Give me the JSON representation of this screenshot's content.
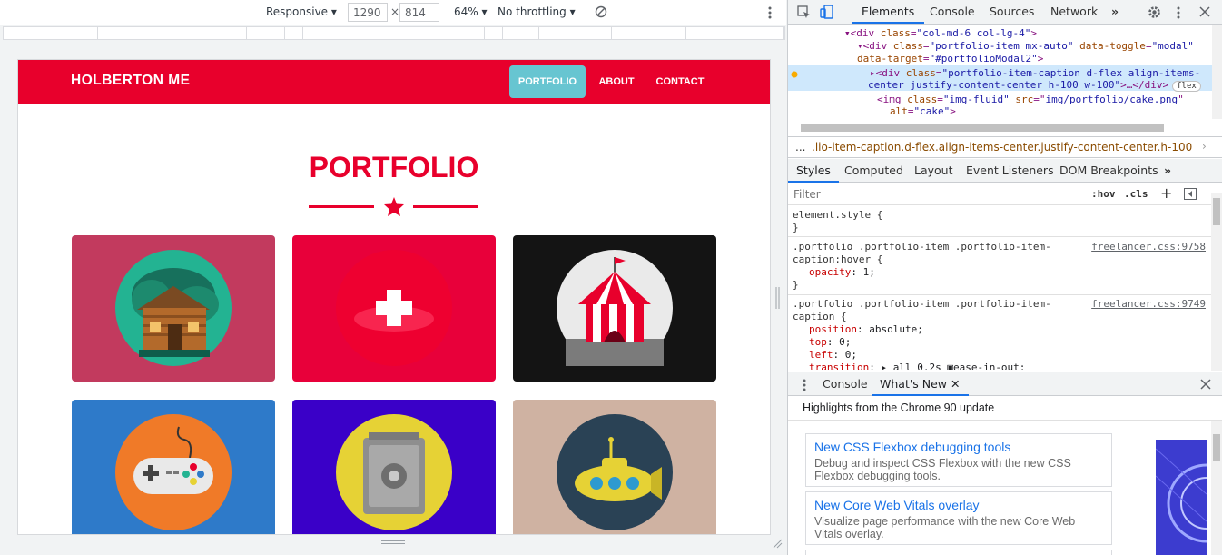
{
  "devbar": {
    "device": "Responsive",
    "width": "1290",
    "times": "×",
    "height": "814",
    "zoom": "64%",
    "throttling": "No throttling"
  },
  "page": {
    "brand": "HOLBERTON ME",
    "nav": [
      {
        "label": "PORTFOLIO",
        "active": true
      },
      {
        "label": "ABOUT",
        "active": false
      },
      {
        "label": "CONTACT",
        "active": false
      }
    ],
    "heading": "PORTFOLIO",
    "cards": [
      {
        "name": "cabin",
        "bg": "#c23a5e",
        "circle": "#23b392"
      },
      {
        "name": "cake",
        "bg": "#e8003a",
        "circle": "#ee0030"
      },
      {
        "name": "circus",
        "bg": "#141414",
        "circle": "#eaeaea"
      },
      {
        "name": "game",
        "bg": "#2e7ac9",
        "circle": "#f07a28"
      },
      {
        "name": "safe",
        "bg": "#3a00c8",
        "circle": "#e6d235"
      },
      {
        "name": "submarine",
        "bg": "#cfb2a2",
        "circle": "#2a4255"
      }
    ],
    "colors": {
      "accent": "#e8002c",
      "active_nav": "#67c5d1"
    }
  },
  "devtools": {
    "main_tabs": [
      "Elements",
      "Console",
      "Sources",
      "Network"
    ],
    "dom": {
      "line1_tag_open": "<div ",
      "line1_attr": "class",
      "line1_val": "\"col-md-6 col-lg-4\"",
      "line1_close": ">",
      "line2_tag_open": "<div ",
      "line2_attr1": "class",
      "line2_val1": "\"portfolio-item mx-auto\"",
      "line2_attr2": "data-toggle",
      "line2_val2": "\"modal\"",
      "line3_attr": "data-target",
      "line3_val": "\"#portfolioModal2\"",
      "line3_close": ">",
      "line4_tag_open": "<div ",
      "line4_attr": "class",
      "line4_val": "\"portfolio-item-caption d-flex align-items-",
      "line5_val": "center justify-content-center h-100 w-100\"",
      "line5_close": ">…</div>",
      "line5_badge": "flex",
      "line6_tag_open": "<img ",
      "line6_attr1": "class",
      "line6_val1": "\"img-fluid\"",
      "line6_attr2": "src",
      "line6_val2": "img/portfolio/cake.png",
      "line7_attr": "alt",
      "line7_val": "\"cake\"",
      "line7_close": ">"
    },
    "breadcrumb": "...",
    "breadcrumb_path": ".lio-item-caption.d-flex.align-items-center.justify-content-center.h-100.w-100",
    "style_tabs": [
      "Styles",
      "Computed",
      "Layout",
      "Event Listeners",
      "DOM Breakpoints"
    ],
    "filter_placeholder": "Filter",
    "hov": ":hov",
    "cls": ".cls",
    "rules": [
      {
        "selector": "element.style {",
        "close": "}"
      },
      {
        "selector1": ".portfolio .portfolio-item .portfolio-item-",
        "selector2": "caption:hover {",
        "source": "freelancer.css:9758",
        "decls": [
          {
            "prop": "opacity",
            "value": "1;"
          }
        ],
        "close": "}"
      },
      {
        "selector1": ".portfolio .portfolio-item .portfolio-item-",
        "selector2": "caption {",
        "source": "freelancer.css:9749",
        "decls": [
          {
            "prop": "position",
            "value": "absolute;"
          },
          {
            "prop": "top",
            "value": "0;"
          },
          {
            "prop": "left",
            "value": "0;"
          },
          {
            "prop": "transition",
            "value": "▸ all 0.2s ▣ease-in-out;"
          }
        ]
      }
    ],
    "drawer_tabs": [
      "Console",
      "What's New"
    ],
    "whats_new": {
      "highlight": "Highlights from the Chrome 90 update",
      "items": [
        {
          "title": "New CSS Flexbox debugging tools",
          "desc": "Debug and inspect CSS Flexbox with the new CSS Flexbox debugging tools."
        },
        {
          "title": "New Core Web Vitals overlay",
          "desc": "Visualize page performance with the new Core Web Vitals overlay."
        }
      ]
    }
  }
}
